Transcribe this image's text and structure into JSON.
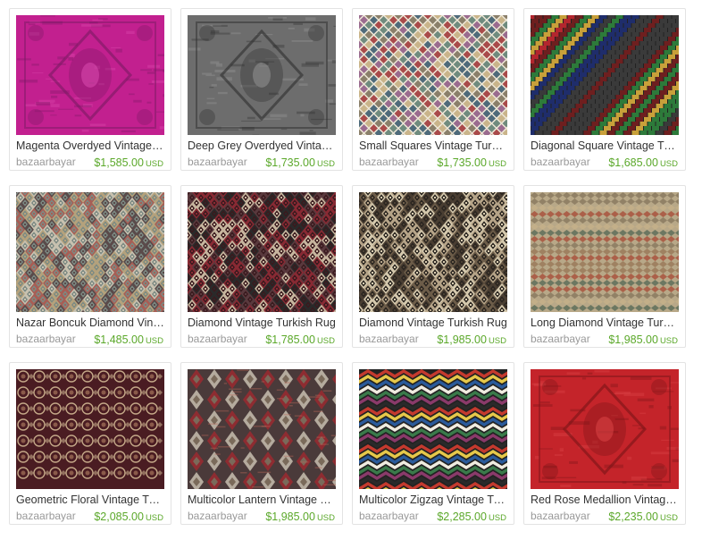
{
  "listings": [
    {
      "title": "Magenta Overdyed Vintage T...",
      "shop": "bazaarbayar",
      "price": "$1,585.00",
      "currency": "USD",
      "image": {
        "kind": "overdyed-medallion",
        "base": "#c2208f",
        "light": "#e04fb3",
        "dark": "#7a1a63"
      }
    },
    {
      "title": "Deep Grey Overdyed Vintage...",
      "shop": "bazaarbayar",
      "price": "$1,735.00",
      "currency": "USD",
      "image": {
        "kind": "overdyed-medallion",
        "base": "#6d6d6d",
        "light": "#9a9a9a",
        "dark": "#2e2e2e"
      }
    },
    {
      "title": "Small Squares Vintage Turkis...",
      "shop": "bazaarbayar",
      "price": "$1,735.00",
      "currency": "USD",
      "image": {
        "kind": "checker-diamond",
        "colors": [
          "#8a7f6a",
          "#6f8b7e",
          "#a94a4a",
          "#c9b48a",
          "#4e6a7a",
          "#9a6b8f"
        ]
      }
    },
    {
      "title": "Diagonal Square Vintage Tur...",
      "shop": "bazaarbayar",
      "price": "$1,685.00",
      "currency": "USD",
      "image": {
        "kind": "diagonal-stripes",
        "colors": [
          "#b3262e",
          "#2d7a3a",
          "#c8a03a",
          "#1f2d6b",
          "#6e1f1f",
          "#3a3a3a"
        ]
      }
    },
    {
      "title": "Nazar Boncuk Diamond Vinta...",
      "shop": "bazaarbayar",
      "price": "$1,485.00",
      "currency": "USD",
      "image": {
        "kind": "diamond-lattice",
        "colors": [
          "#7c8a83",
          "#b5a27c",
          "#5a4a4a",
          "#a85e55",
          "#c9c2b0"
        ]
      }
    },
    {
      "title": "Diamond Vintage Turkish Rug",
      "shop": "bazaarbayar",
      "price": "$1,785.00",
      "currency": "USD",
      "image": {
        "kind": "diamond-lattice",
        "colors": [
          "#3a1a1e",
          "#8a2a34",
          "#c9b8a0",
          "#5a3a3e",
          "#2a2a2a"
        ]
      }
    },
    {
      "title": "Diamond Vintage Turkish Rug",
      "shop": "bazaarbayar",
      "price": "$1,985.00",
      "currency": "USD",
      "image": {
        "kind": "diamond-lattice",
        "colors": [
          "#2a2520",
          "#b8a68a",
          "#6e5e4a",
          "#d8ccb0",
          "#4a3e32"
        ]
      }
    },
    {
      "title": "Long Diamond Vintage Turkis...",
      "shop": "bazaarbayar",
      "price": "$1,985.00",
      "currency": "USD",
      "image": {
        "kind": "horizontal-bands",
        "colors": [
          "#8a7a60",
          "#5e6e5a",
          "#a8543e",
          "#c4b08a",
          "#4a4a5a",
          "#9a7a5a"
        ]
      }
    },
    {
      "title": "Geometric Floral Vintage Tur...",
      "shop": "bazaarbayar",
      "price": "$2,085.00",
      "currency": "USD",
      "image": {
        "kind": "floral-grid",
        "colors": [
          "#4a1c22",
          "#8a5a4a",
          "#c4a888",
          "#2e1418"
        ]
      }
    },
    {
      "title": "Multicolor Lantern Vintage Tu...",
      "shop": "bazaarbayar",
      "price": "$1,985.00",
      "currency": "USD",
      "image": {
        "kind": "lantern-rows",
        "colors": [
          "#9a2a30",
          "#c8c0b0",
          "#4a3a3a",
          "#7a6a5a",
          "#b86a5a"
        ]
      }
    },
    {
      "title": "Multicolor Zigzag Vintage Tur...",
      "shop": "bazaarbayar",
      "price": "$2,285.00",
      "currency": "USD",
      "image": {
        "kind": "zigzag",
        "colors": [
          "#c43a2e",
          "#e6c84a",
          "#2a5a9a",
          "#f0ece0",
          "#3a7a4a",
          "#8a3a6a",
          "#2a2a2a"
        ]
      }
    },
    {
      "title": "Red Rose Medallion Vintage ...",
      "shop": "bazaarbayar",
      "price": "$2,235.00",
      "currency": "USD",
      "image": {
        "kind": "overdyed-medallion",
        "base": "#c4242a",
        "light": "#e0484a",
        "dark": "#7a1418"
      }
    }
  ]
}
